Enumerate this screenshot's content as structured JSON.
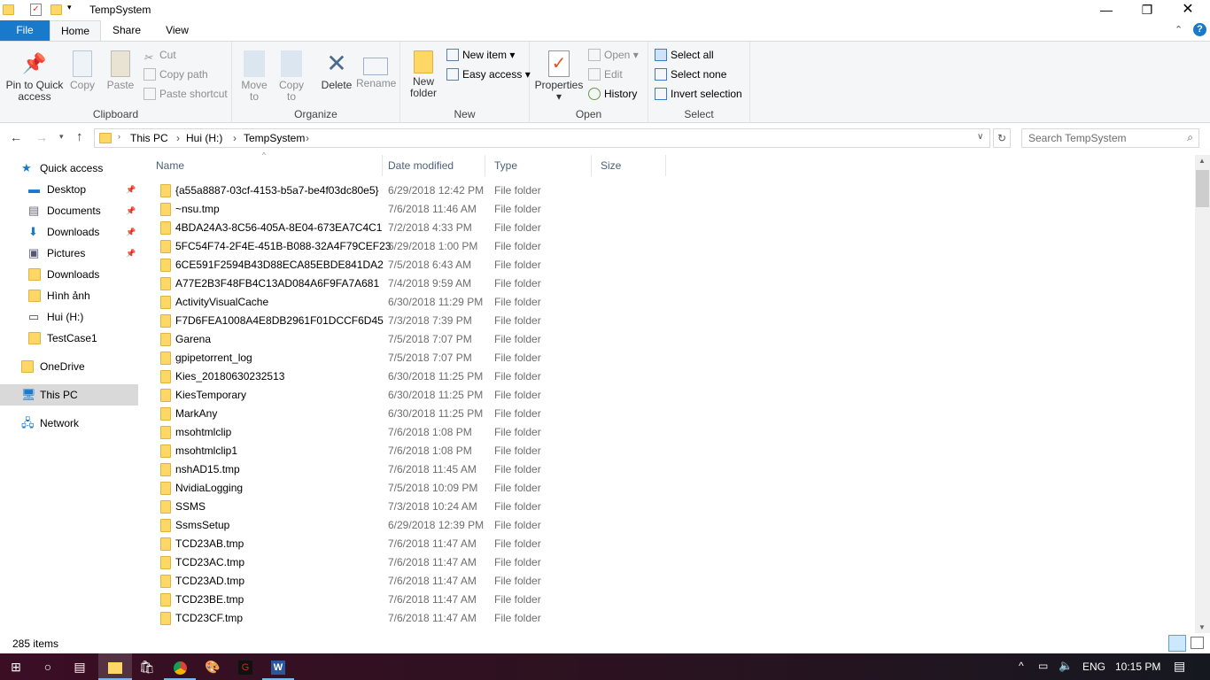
{
  "window": {
    "title": "TempSystem"
  },
  "tabs": [
    {
      "label": "File"
    },
    {
      "label": "Home"
    },
    {
      "label": "Share"
    },
    {
      "label": "View"
    }
  ],
  "ribbon": {
    "clipboard": {
      "label": "Clipboard",
      "pin": "Pin to Quick access",
      "copy": "Copy",
      "paste": "Paste",
      "cut": "Cut",
      "copy_path": "Copy path",
      "paste_shortcut": "Paste shortcut"
    },
    "organize": {
      "label": "Organize",
      "move_to": "Move to",
      "copy_to": "Copy to",
      "delete": "Delete",
      "rename": "Rename"
    },
    "new": {
      "label": "New",
      "new_folder": "New folder",
      "new_item": "New item",
      "easy_access": "Easy access"
    },
    "open": {
      "label": "Open",
      "properties": "Properties",
      "open": "Open",
      "edit": "Edit",
      "history": "History"
    },
    "select": {
      "label": "Select",
      "select_all": "Select all",
      "select_none": "Select none",
      "invert": "Invert selection"
    }
  },
  "address": {
    "crumbs": [
      "This PC",
      "Hui (H:)",
      "TempSystem"
    ],
    "search_placeholder": "Search TempSystem"
  },
  "nav": [
    {
      "label": "Quick access",
      "icon": "star-icon"
    },
    {
      "label": "Desktop",
      "icon": "desktop-icon",
      "pinned": true
    },
    {
      "label": "Documents",
      "icon": "documents-icon",
      "pinned": true
    },
    {
      "label": "Downloads",
      "icon": "download-icon",
      "pinned": true
    },
    {
      "label": "Pictures",
      "icon": "pictures-icon",
      "pinned": true
    },
    {
      "label": "Downloads",
      "icon": "folder-icon"
    },
    {
      "label": "Hình ảnh",
      "icon": "folder-icon"
    },
    {
      "label": "Hui (H:)",
      "icon": "drive-icon"
    },
    {
      "label": "TestCase1",
      "icon": "folder-icon"
    },
    {
      "label": "OneDrive",
      "icon": "folder-icon"
    },
    {
      "label": "This PC",
      "icon": "computer-icon",
      "selected": true
    },
    {
      "label": "Network",
      "icon": "network-icon"
    }
  ],
  "columns": {
    "name": "Name",
    "date": "Date modified",
    "type": "Type",
    "size": "Size"
  },
  "files": [
    {
      "name": "{a55a8887-03cf-4153-b5a7-be4f03dc80e5}",
      "date": "6/29/2018 12:42 PM",
      "type": "File folder"
    },
    {
      "name": "~nsu.tmp",
      "date": "7/6/2018 11:46 AM",
      "type": "File folder"
    },
    {
      "name": "4BDA24A3-8C56-405A-8E04-673EA7C4C1",
      "date": "7/2/2018 4:33 PM",
      "type": "File folder"
    },
    {
      "name": "5FC54F74-2F4E-451B-B088-32A4F79CEF23",
      "date": "6/29/2018 1:00 PM",
      "type": "File folder"
    },
    {
      "name": "6CE591F2594B43D88ECA85EBDE841DA2",
      "date": "7/5/2018 6:43 AM",
      "type": "File folder"
    },
    {
      "name": "A77E2B3F48FB4C13AD084A6F9FA7A681",
      "date": "7/4/2018 9:59 AM",
      "type": "File folder"
    },
    {
      "name": "ActivityVisualCache",
      "date": "6/30/2018 11:29 PM",
      "type": "File folder"
    },
    {
      "name": "F7D6FEA1008A4E8DB2961F01DCCF6D45",
      "date": "7/3/2018 7:39 PM",
      "type": "File folder"
    },
    {
      "name": "Garena",
      "date": "7/5/2018 7:07 PM",
      "type": "File folder"
    },
    {
      "name": "gpipetorrent_log",
      "date": "7/5/2018 7:07 PM",
      "type": "File folder"
    },
    {
      "name": "Kies_20180630232513",
      "date": "6/30/2018 11:25 PM",
      "type": "File folder"
    },
    {
      "name": "KiesTemporary",
      "date": "6/30/2018 11:25 PM",
      "type": "File folder"
    },
    {
      "name": "MarkAny",
      "date": "6/30/2018 11:25 PM",
      "type": "File folder"
    },
    {
      "name": "msohtmlclip",
      "date": "7/6/2018 1:08 PM",
      "type": "File folder"
    },
    {
      "name": "msohtmlclip1",
      "date": "7/6/2018 1:08 PM",
      "type": "File folder"
    },
    {
      "name": "nshAD15.tmp",
      "date": "7/6/2018 11:45 AM",
      "type": "File folder"
    },
    {
      "name": "NvidiaLogging",
      "date": "7/5/2018 10:09 PM",
      "type": "File folder"
    },
    {
      "name": "SSMS",
      "date": "7/3/2018 10:24 AM",
      "type": "File folder"
    },
    {
      "name": "SsmsSetup",
      "date": "6/29/2018 12:39 PM",
      "type": "File folder"
    },
    {
      "name": "TCD23AB.tmp",
      "date": "7/6/2018 11:47 AM",
      "type": "File folder"
    },
    {
      "name": "TCD23AC.tmp",
      "date": "7/6/2018 11:47 AM",
      "type": "File folder"
    },
    {
      "name": "TCD23AD.tmp",
      "date": "7/6/2018 11:47 AM",
      "type": "File folder"
    },
    {
      "name": "TCD23BE.tmp",
      "date": "7/6/2018 11:47 AM",
      "type": "File folder"
    },
    {
      "name": "TCD23CF.tmp",
      "date": "7/6/2018 11:47 AM",
      "type": "File folder"
    }
  ],
  "status": {
    "count": "285 items"
  },
  "taskbar": {
    "lang": "ENG",
    "time": "10:15 PM"
  },
  "colors": {
    "accent": "#1979ca",
    "folder": "#ffd767",
    "selected": "#cce8ff"
  }
}
